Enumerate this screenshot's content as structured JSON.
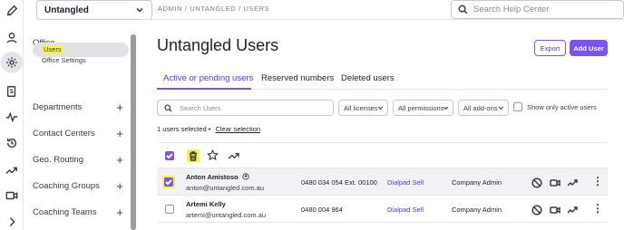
{
  "office_selector": {
    "value": "Untangled"
  },
  "breadcrumb": "ADMIN / UNTANGLED / USERS",
  "help_search": {
    "placeholder": "Search Help Center"
  },
  "sidebar": {
    "office_section": "Office",
    "office_settings": "Office Settings",
    "users": "Users",
    "groups": [
      {
        "label": "Departments"
      },
      {
        "label": "Contact Centers"
      },
      {
        "label": "Geo. Routing"
      },
      {
        "label": "Coaching Groups"
      },
      {
        "label": "Coaching Teams"
      }
    ],
    "plus_symbol": "+"
  },
  "page": {
    "title": "Untangled Users",
    "export_label": "Export",
    "add_user_label": "Add User"
  },
  "tabs": [
    {
      "label": "Active or pending users",
      "active": true
    },
    {
      "label": "Reserved numbers",
      "active": false
    },
    {
      "label": "Deleted users",
      "active": false
    }
  ],
  "filters": {
    "search_placeholder": "Search Users",
    "licenses": "All licenses",
    "permissions": "All permissions",
    "addons": "All add-ons",
    "show_only_active": "Show only active users"
  },
  "selection": {
    "summary": "1 users selected",
    "separator": "•",
    "clear": "Clear selection"
  },
  "users": [
    {
      "name": "Anton Amistoso",
      "email": "anton@untangled.com.au",
      "phone": "0480 034 054 Ext. 00100",
      "plan": "Dialpad Sell",
      "role": "Company Admin",
      "selected": true,
      "badge_icon": "soccer-ball-icon"
    },
    {
      "name": "Artemi Kelly",
      "email": "artemi@untangled.com.au",
      "phone": "0480 004 964",
      "plan": "Dialpad Sell",
      "role": "Company Admin",
      "selected": false
    }
  ],
  "row_kebab": "⋮",
  "colors": {
    "accent": "#7c52f0",
    "highlight": "#f6f24a",
    "link": "#5a35d8"
  }
}
